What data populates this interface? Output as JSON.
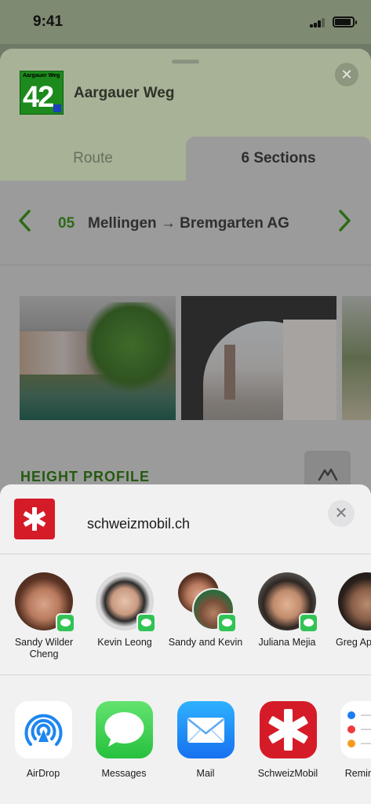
{
  "status_bar": {
    "time": "9:41"
  },
  "route": {
    "logo_title": "Aargauer Weg",
    "logo_number": "42",
    "name": "Aargauer Weg",
    "close_glyph": "✕"
  },
  "tabs": [
    {
      "label": "Route",
      "selected": false
    },
    {
      "label": "6 Sections",
      "selected": true
    }
  ],
  "section_nav": {
    "number": "05",
    "title": "Mellingen → Bremgarten AG",
    "prev_glyph": "‹",
    "next_glyph": "›"
  },
  "height_profile": {
    "title": "HEIGHT PROFILE",
    "icon": "mountain-icon"
  },
  "share": {
    "url": "schweizmobil.ch",
    "close_glyph": "✕",
    "people": [
      {
        "name": "Sandy Wilder Cheng",
        "badge": "messages-icon"
      },
      {
        "name": "Kevin Leong",
        "badge": "messages-icon"
      },
      {
        "name": "Sandy and Kevin",
        "badge": "messages-icon"
      },
      {
        "name": "Juliana Mejia",
        "badge": "messages-icon"
      },
      {
        "name": "Greg Apodaca",
        "badge": "messages-icon"
      }
    ],
    "apps": [
      {
        "name": "AirDrop",
        "icon": "airdrop-icon"
      },
      {
        "name": "Messages",
        "icon": "messages-app-icon"
      },
      {
        "name": "Mail",
        "icon": "mail-icon"
      },
      {
        "name": "SchweizMobil",
        "icon": "schweizmobil-icon"
      },
      {
        "name": "Reminders",
        "icon": "reminders-icon"
      }
    ]
  },
  "colors": {
    "accent_green": "#2c6b16",
    "brand_red": "#d61b28",
    "message_green": "#31c454"
  }
}
